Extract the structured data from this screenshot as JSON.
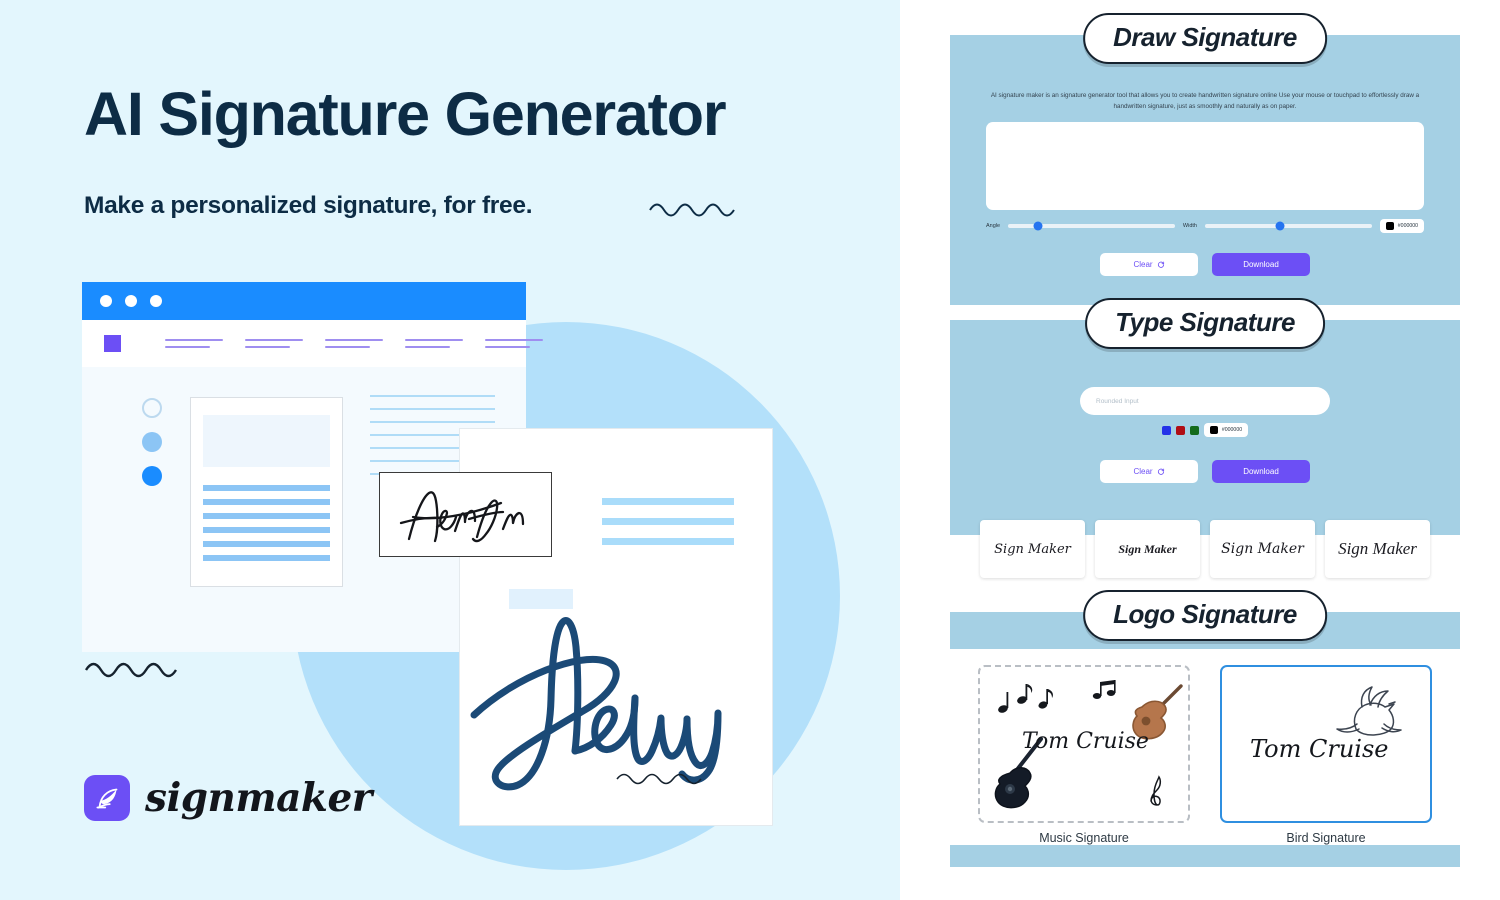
{
  "hero": {
    "title": "AI Signature Generator",
    "subtitle": "Make a personalized signature, for free."
  },
  "brand": {
    "name": "signmaker",
    "icon": "feather-quill-icon",
    "mark_color": "#6c4ff5"
  },
  "illustration": {
    "small_signature": "AronJan",
    "large_signature": "Belluy",
    "browser_dots": 3
  },
  "colors": {
    "page_background": "#e3f6fd",
    "panel_blue": "#a5d0e4",
    "accent_purple": "#6c4ff5",
    "accent_blue": "#1a8cff",
    "ink_navy": "#0d2c45",
    "signature_navy": "#1b4a77"
  },
  "panels": {
    "draw": {
      "heading": "Draw Signature",
      "description": "AI signature maker is an signature generator tool that allows you to create handwritten signature online Use your mouse or touchpad to effortlessly draw a handwritten signature, just as smoothly and naturally as on paper.",
      "canvas_placeholder": "",
      "controls": {
        "angle_label": "Angle",
        "angle_value": 18,
        "width_label": "Width",
        "width_value": 45,
        "color_value": "#000000"
      },
      "buttons": {
        "clear": "Clear",
        "clear_icon": "refresh-icon",
        "download": "Download"
      }
    },
    "type": {
      "heading": "Type Signature",
      "input_placeholder": "Rounded Input",
      "input_value": "",
      "swatches": [
        "#2432e8",
        "#b00d14",
        "#146b1c"
      ],
      "color_value": "#000000",
      "buttons": {
        "clear": "Clear",
        "clear_icon": "refresh-icon",
        "download": "Download"
      },
      "font_previews": [
        {
          "label": "Sign Maker"
        },
        {
          "label": "Sign Maker"
        },
        {
          "label": "Sign Maker"
        },
        {
          "label": "Sign Maker"
        }
      ]
    },
    "logo": {
      "heading": "Logo Signature",
      "tiles": [
        {
          "caption": "Music Signature",
          "signature": "Tom Cruise",
          "selected": false,
          "decor": [
            "guitar-icon",
            "music-note-icon",
            "treble-clef-icon"
          ]
        },
        {
          "caption": "Bird Signature",
          "signature": "Tom Cruise",
          "selected": true,
          "decor": [
            "dove-bird-icon"
          ]
        }
      ]
    }
  }
}
